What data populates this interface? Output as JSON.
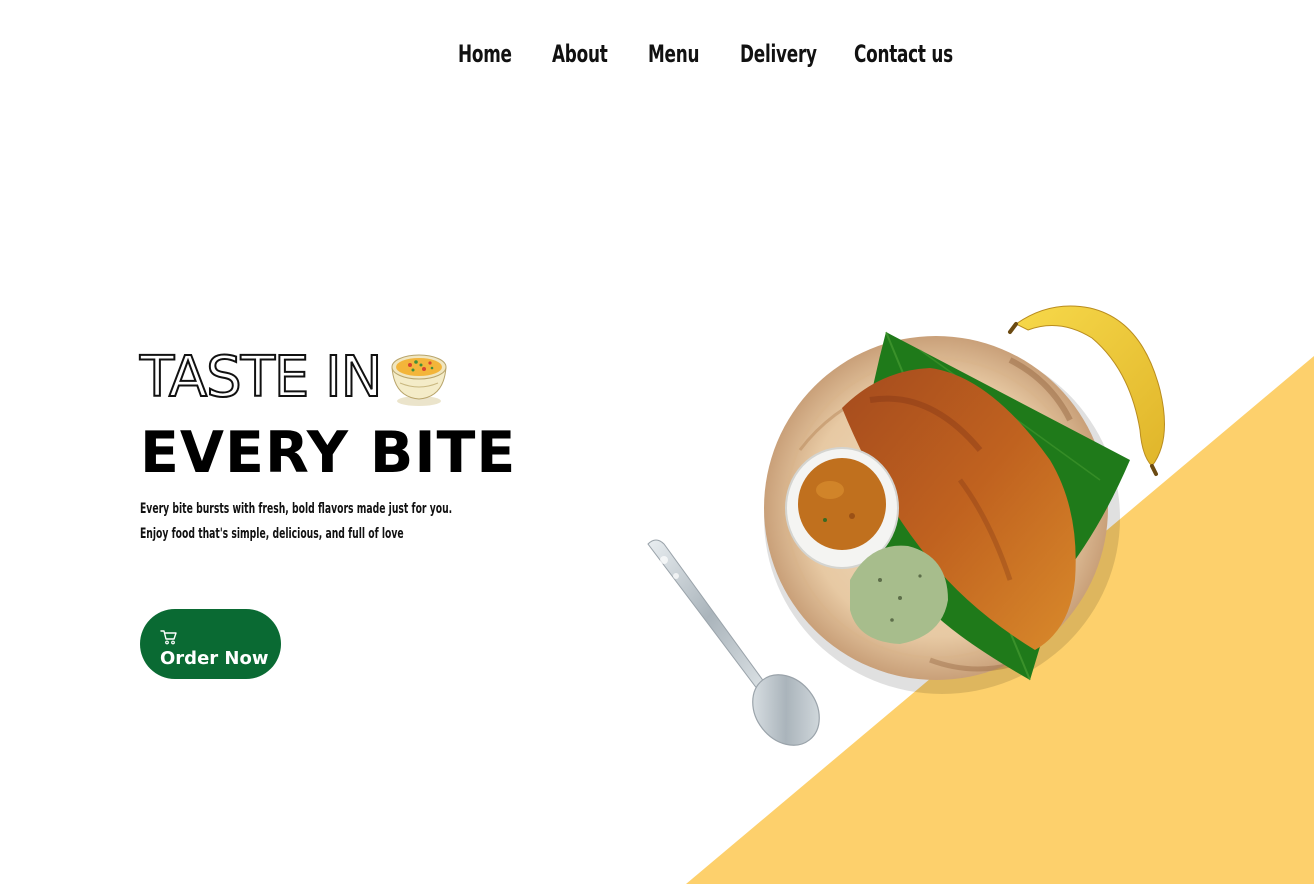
{
  "nav": {
    "items": [
      {
        "label": "Home"
      },
      {
        "label": "About"
      },
      {
        "label": "Menu"
      },
      {
        "label": "Delivery"
      },
      {
        "label": "Contact us"
      }
    ]
  },
  "hero": {
    "title_line1": "TASTE IN",
    "title_line2": "EVERY BITE",
    "description": [
      "Every bite bursts with fresh, bold flavors made just for you.",
      "Enjoy food that's simple, delicious, and full of love"
    ],
    "title_icon": "soup-bowl-icon",
    "cta": {
      "label": "Order Now",
      "icon": "cart-icon"
    }
  },
  "illustration": {
    "items": [
      "dosa-plate",
      "banana",
      "spoon",
      "sambar-bowl",
      "chutney",
      "banana-leaf"
    ]
  },
  "colors": {
    "accent_yellow": "#fdd06c",
    "button_green": "#0a6a33",
    "text": "#111111",
    "background": "#ffffff"
  }
}
